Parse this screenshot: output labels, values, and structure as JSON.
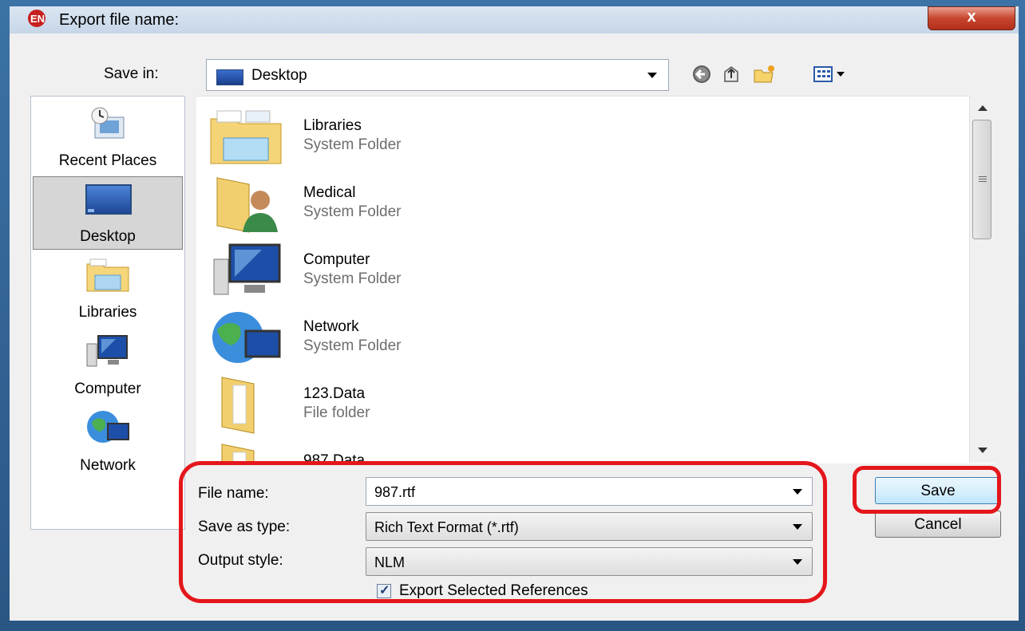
{
  "window": {
    "title": "Export file name:",
    "close_glyph": "x"
  },
  "toolbar": {
    "save_in_label": "Save in:",
    "save_in_value": "Desktop",
    "icons": [
      "back-icon",
      "up-folder-icon",
      "new-folder-icon",
      "view-menu-icon"
    ]
  },
  "places": [
    {
      "label": "Recent Places",
      "icon": "recent-places-icon",
      "selected": false
    },
    {
      "label": "Desktop",
      "icon": "desktop-icon",
      "selected": true
    },
    {
      "label": "Libraries",
      "icon": "libraries-icon",
      "selected": false
    },
    {
      "label": "Computer",
      "icon": "computer-icon",
      "selected": false
    },
    {
      "label": "Network",
      "icon": "network-icon",
      "selected": false
    }
  ],
  "files": [
    {
      "name": "Libraries",
      "type": "System Folder",
      "icon": "libraries-folder-icon"
    },
    {
      "name": "Medical",
      "type": "System Folder",
      "icon": "user-folder-icon"
    },
    {
      "name": "Computer",
      "type": "System Folder",
      "icon": "computer-icon"
    },
    {
      "name": "Network",
      "type": "System Folder",
      "icon": "network-icon"
    },
    {
      "name": "123.Data",
      "type": "File folder",
      "icon": "folder-icon"
    },
    {
      "name": "987.Data",
      "type": "",
      "icon": "folder-icon"
    }
  ],
  "form": {
    "file_name_label": "File name:",
    "file_name_value": "987.rtf",
    "save_as_type_label": "Save as type:",
    "save_as_type_value": "Rich Text Format (*.rtf)",
    "output_style_label": "Output style:",
    "output_style_value": "NLM",
    "export_selected_label": "Export Selected References",
    "export_selected_checked": true
  },
  "buttons": {
    "save_label": "Save",
    "cancel_label": "Cancel"
  },
  "colors": {
    "highlight": "#e4161b",
    "frame": "#2d5b8c"
  }
}
